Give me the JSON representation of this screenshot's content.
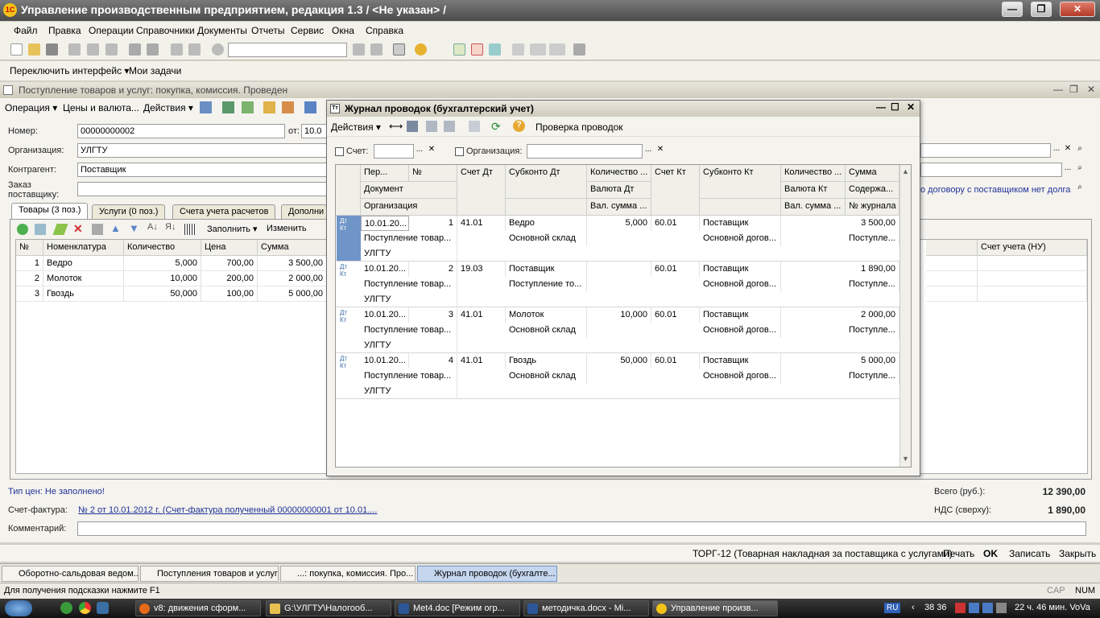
{
  "app": {
    "title": "Управление производственным предприятием, редакция 1.3 / <Не указан> /",
    "logo": "1С",
    "win_min": "—",
    "win_max": "❐",
    "win_close": "✕"
  },
  "menu": [
    "Файл",
    "Правка",
    "Операции",
    "Справочники",
    "Документы",
    "Отчеты",
    "Сервис",
    "Окна",
    "Справка"
  ],
  "toolbar2": {
    "switch_interface": "Переключить интерфейс ▾",
    "my_tasks": "Мои задачи"
  },
  "document": {
    "title": "Поступление товаров и услуг: покупка, комиссия. Проведен",
    "toolbar": {
      "operation": "Операция ▾",
      "prices": "Цены и валюта...",
      "actions": "Действия ▾"
    },
    "labels": {
      "number": "Номер:",
      "from": "от:",
      "org": "Организация:",
      "counterparty": "Контрагент:",
      "order_line1": "Заказ",
      "order_line2": "поставщику:"
    },
    "values": {
      "number": "00000000002",
      "date": "10.0",
      "org": "УЛГТУ",
      "counterparty": "Поставщик",
      "order": ""
    },
    "contract_note": "о договору с поставщиком нет долга",
    "tabs": [
      "Товары (3 поз.)",
      "Услуги (0 поз.)",
      "Счета учета расчетов",
      "Дополни"
    ],
    "goods_toolbar": {
      "fill": "Заполнить ▾",
      "change": "Изменить"
    },
    "goods_columns": [
      "№",
      "Номенклатура",
      "Количество",
      "Цена",
      "Сумма"
    ],
    "right_column": "Счет учета (НУ)",
    "goods_rows": [
      {
        "n": "1",
        "name": "Ведро",
        "qty": "5,000",
        "price": "700,00",
        "sum": "3 500,00"
      },
      {
        "n": "2",
        "name": "Молоток",
        "qty": "10,000",
        "price": "200,00",
        "sum": "2 000,00"
      },
      {
        "n": "3",
        "name": "Гвоздь",
        "qty": "50,000",
        "price": "100,00",
        "sum": "5 000,00"
      }
    ],
    "price_type": "Тип цен: Не заполнено!",
    "total_label": "Всего (руб.):",
    "total_value": "12 390,00",
    "vat_label": "НДС (сверху):",
    "vat_value": "1 890,00",
    "invoice_label": "Счет-фактура:",
    "invoice_value": "№ 2 от 10.01.2012 г. (Счет-фактура полученный 00000000001 от 10.01....",
    "comment_label": "Комментарий:",
    "bottom": {
      "torg": "ТОРГ-12 (Товарная накладная за поставщика с услугами)",
      "print": "Печать",
      "ok": "OK",
      "save": "Записать",
      "close": "Закрыть"
    }
  },
  "journal": {
    "title": "Журнал проводок (бухгалтерский учет)",
    "toolbar": {
      "actions": "Действия ▾",
      "check": "Проверка проводок"
    },
    "filter": {
      "account": "Счет:",
      "org": "Организация:"
    },
    "headers": {
      "period": "Пер...",
      "no": "№",
      "doc": "Документ",
      "org": "Организация",
      "dt": "Счет Дт",
      "sub_dt": "Субконто Дт",
      "qty_dt": "Количество ...",
      "cur_dt": "Валюта Дт",
      "cur_sum_dt": "Вал. сумма ...",
      "kt": "Счет Кт",
      "sub_kt": "Субконто Кт",
      "qty_kt": "Количество ...",
      "cur_kt": "Валюта Кт",
      "cur_sum_kt": "Вал. сумма ...",
      "sum": "Сумма",
      "content": "Содержа...",
      "journal_no": "№ журнала"
    },
    "rows": [
      {
        "period": "10.01.20...",
        "no": "1",
        "doc": "Поступление товар...",
        "org": "УЛГТУ",
        "dt": "41.01",
        "sub_dt1": "Ведро",
        "sub_dt2": "Основной склад",
        "qty_dt": "5,000",
        "kt": "60.01",
        "sub_kt1": "Поставщик",
        "sub_kt2": "Основной догов...",
        "sum": "3 500,00",
        "content": "Поступле..."
      },
      {
        "period": "10.01.20...",
        "no": "2",
        "doc": "Поступление товар...",
        "org": "УЛГТУ",
        "dt": "19.03",
        "sub_dt1": "Поставщик",
        "sub_dt2": "Поступление то...",
        "qty_dt": "",
        "kt": "60.01",
        "sub_kt1": "Поставщик",
        "sub_kt2": "Основной догов...",
        "sum": "1 890,00",
        "content": "Поступле..."
      },
      {
        "period": "10.01.20...",
        "no": "3",
        "doc": "Поступление товар...",
        "org": "УЛГТУ",
        "dt": "41.01",
        "sub_dt1": "Молоток",
        "sub_dt2": "Основной склад",
        "qty_dt": "10,000",
        "kt": "60.01",
        "sub_kt1": "Поставщик",
        "sub_kt2": "Основной догов...",
        "sum": "2 000,00",
        "content": "Поступле..."
      },
      {
        "period": "10.01.20...",
        "no": "4",
        "doc": "Поступление товар...",
        "org": "УЛГТУ",
        "dt": "41.01",
        "sub_dt1": "Гвоздь",
        "sub_dt2": "Основной склад",
        "qty_dt": "50,000",
        "kt": "60.01",
        "sub_kt1": "Поставщик",
        "sub_kt2": "Основной догов...",
        "sum": "5 000,00",
        "content": "Поступле..."
      }
    ]
  },
  "open_windows": [
    "Оборотно-сальдовая ведом...",
    "Поступления товаров и услуг",
    "...: покупка, комиссия. Про...",
    "Журнал проводок (бухгалте..."
  ],
  "status": {
    "hint": "Для получения подсказки нажмите F1",
    "cap": "CAP",
    "num": "NUM"
  },
  "taskbar": {
    "items": [
      "v8: движения сформ...",
      "G:\\УЛГТУ\\Налогооб...",
      "Met4.doc [Режим огр...",
      "методичка.docx - Mi...",
      "Управление произв..."
    ],
    "lang": "RU",
    "clock": "22 ч. 46 мин. VoVa",
    "net": "38 36"
  },
  "colors": {
    "accent": "#3a6ea5",
    "link": "#223399",
    "selected_row": "#6f94c8"
  }
}
